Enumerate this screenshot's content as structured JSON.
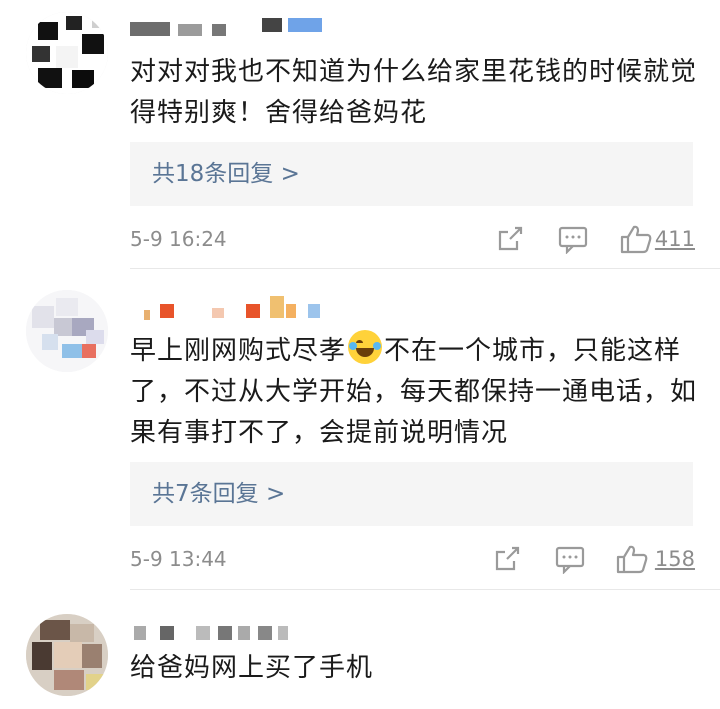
{
  "comments": [
    {
      "text": "对对对我也不知道为什么给家里花钱的时候就觉得特别爽！舍得给爸妈花",
      "replies_label": "共18条回复 >",
      "time": "5-9 16:24",
      "like_count": "411"
    },
    {
      "text_before_emoji": "早上刚网购式尽孝",
      "emoji": "tears-of-joy-emoji",
      "text_after_emoji": "不在一个城市，只能这样了，不过从大学开始，每天都保持一通电话，如果有事打不了，会提前说明情况",
      "replies_label": "共7条回复 >",
      "time": "5-9 13:44",
      "like_count": "158"
    },
    {
      "text": "给爸妈网上买了手机"
    }
  ],
  "icons": {
    "share": "share-icon",
    "comment": "comment-icon",
    "like": "thumbs-up-icon"
  },
  "colors": {
    "link": "#5a7595",
    "muted": "#8c8c8c",
    "reply_bg": "#f5f5f5"
  }
}
